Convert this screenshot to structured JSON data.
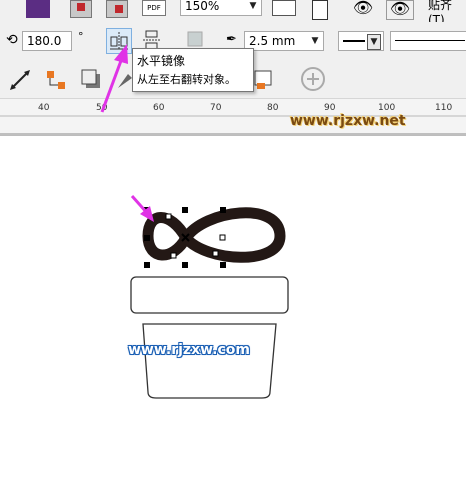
{
  "toolbar_top": {
    "zoom_value": "150%",
    "snap_label": "贴齐(T)"
  },
  "property_bar": {
    "rotation_value": "180.0",
    "rotation_unit": "°",
    "outline_width": "2.5 mm"
  },
  "tooltip": {
    "title": "水平镜像",
    "description": "从左至右翻转对象。"
  },
  "ruler": {
    "ticks": [
      "40",
      "50",
      "60",
      "70",
      "80",
      "90",
      "100",
      "110"
    ]
  },
  "watermarks": {
    "top": "www.rjzxw.net",
    "bottom": "www.rjzxw.com"
  },
  "colors": {
    "accent_arrow": "#e033e6",
    "ribbon_bow": "#231815",
    "toolbar_bg": "#f0f0f0",
    "active_button": "#dbeaf8"
  }
}
